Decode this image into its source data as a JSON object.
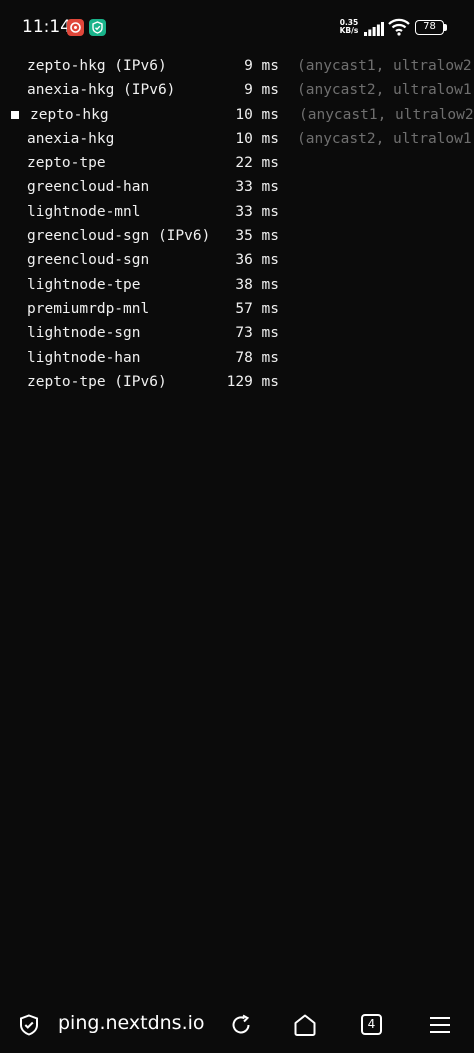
{
  "status_bar": {
    "time": "11:14",
    "net_speed_value": "0.35",
    "net_speed_unit": "KB/s",
    "battery": "78",
    "icons": [
      "app-notification-icon",
      "shield-notification-icon",
      "cellular-signal-icon",
      "wifi-icon",
      "battery-icon"
    ]
  },
  "ping_results": [
    {
      "name": "zepto-hkg (IPv6)",
      "latency": "9 ms",
      "note": "(anycast1, ultralow2"
    },
    {
      "name": "anexia-hkg (IPv6)",
      "latency": "9 ms",
      "note": "(anycast2, ultralow1"
    },
    {
      "name": "zepto-hkg",
      "latency": "10 ms",
      "note": "(anycast1, ultralow2"
    },
    {
      "name": "anexia-hkg",
      "latency": "10 ms",
      "note": "(anycast2, ultralow1"
    },
    {
      "name": "zepto-tpe",
      "latency": "22 ms",
      "note": ""
    },
    {
      "name": "greencloud-han",
      "latency": "33 ms",
      "note": ""
    },
    {
      "name": "lightnode-mnl",
      "latency": "33 ms",
      "note": ""
    },
    {
      "name": "greencloud-sgn (IPv6)",
      "latency": "35 ms",
      "note": ""
    },
    {
      "name": "greencloud-sgn",
      "latency": "36 ms",
      "note": ""
    },
    {
      "name": "lightnode-tpe",
      "latency": "38 ms",
      "note": ""
    },
    {
      "name": "premiumrdp-mnl",
      "latency": "57 ms",
      "note": ""
    },
    {
      "name": "lightnode-sgn",
      "latency": "73 ms",
      "note": ""
    },
    {
      "name": "lightnode-han",
      "latency": "78 ms",
      "note": ""
    },
    {
      "name": "zepto-tpe (IPv6)",
      "latency": "129 ms",
      "note": ""
    }
  ],
  "selected_index": 2,
  "browser_bar": {
    "url": "ping.nextdns.io",
    "tab_count": "4",
    "icons": [
      "secure-shield-icon",
      "reload-icon",
      "home-icon",
      "tabs-icon",
      "menu-icon"
    ]
  }
}
